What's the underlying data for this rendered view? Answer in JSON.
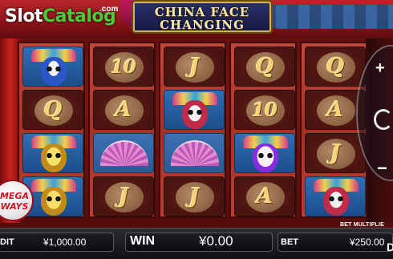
{
  "branding": {
    "logo_slot": "Slot",
    "logo_catalog": "Catalog",
    "logo_com": ".com"
  },
  "game": {
    "title_line1": "CHINA FACE",
    "title_line2": "CHANGING"
  },
  "badge": {
    "line1": "MEGA",
    "line2": "WAYS"
  },
  "reels": [
    [
      "mask-blue",
      "Q",
      "mask-gold",
      "mask-gold"
    ],
    [
      "10",
      "A",
      "fan",
      "J"
    ],
    [
      "J",
      "mask-red",
      "fan",
      "J"
    ],
    [
      "Q",
      "10",
      "mask-white",
      "A"
    ],
    [
      "Q",
      "A",
      "J",
      "mask-red"
    ]
  ],
  "controls": {
    "plus": "+",
    "minus": "−"
  },
  "bottom_bar": {
    "credit_label": "DIT",
    "credit_value": "¥1,000.00",
    "win_label": "WIN",
    "win_value": "¥0.00",
    "bet_label": "BET",
    "bet_value": "¥250.00",
    "bet_multiplier_label": "BET MULTIPLIE",
    "menu_label": "D"
  },
  "colors": {
    "reel_bg": "#b73f32",
    "card_gold": "#f3d27a",
    "bar_bg": "#111114",
    "logo_green": "#4ec93a"
  }
}
